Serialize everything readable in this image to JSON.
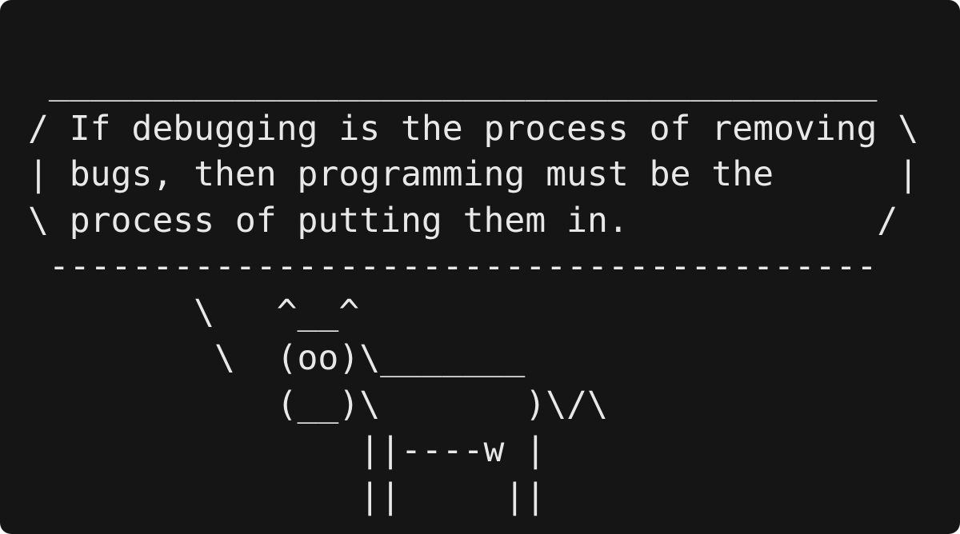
{
  "terminal": {
    "background": "#151515",
    "text_color": "#e8e8e8"
  },
  "cowsay": {
    "lines": [
      " ________________________________________",
      "/ If debugging is the process of removing \\",
      "| bugs, then programming must be the      |",
      "\\ process of putting them in.            /",
      " ----------------------------------------",
      "        \\   ^__^",
      "         \\  (oo)\\_______",
      "            (__)\\       )\\/\\",
      "                ||----w |",
      "                ||     ||"
    ]
  }
}
